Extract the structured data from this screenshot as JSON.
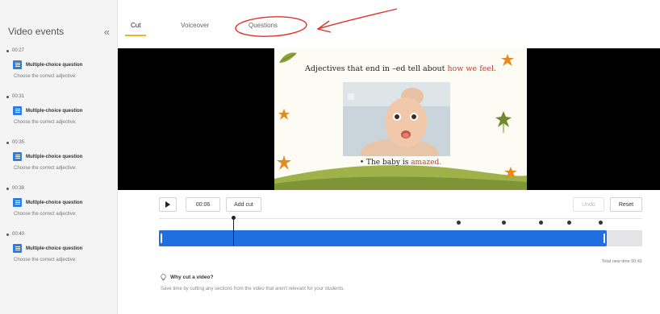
{
  "sidebar": {
    "title": "Video events",
    "collapse_icon": "double-chevron-left-icon",
    "events": [
      {
        "time": "00:27",
        "type": "Multiple-choice question",
        "prompt": "Choose the correct adjective:"
      },
      {
        "time": "00:31",
        "type": "Multiple-choice question",
        "prompt": "Choose the correct adjective:"
      },
      {
        "time": "00:35",
        "type": "Multiple-choice question",
        "prompt": "Choose the correct adjective:"
      },
      {
        "time": "00:38",
        "type": "Multiple-choice question",
        "prompt": "Choose the correct adjective:"
      },
      {
        "time": "00:40",
        "type": "Multiple-choice question",
        "prompt": "Choose the correct adjective:"
      }
    ]
  },
  "tabs": [
    {
      "label": "Cut",
      "active": true
    },
    {
      "label": "Voiceover",
      "active": false
    },
    {
      "label": "Questions",
      "active": false
    }
  ],
  "slide": {
    "title_main": "Adjectives that end in –ed tell about ",
    "title_highlight": "how we feel.",
    "caption_main": "• The baby is ",
    "caption_highlight": "amazed.",
    "highlight_color": "#e0312b"
  },
  "controls": {
    "play_icon": "play-icon",
    "time": "00:06",
    "add_cut": "Add cut",
    "undo": "Undo",
    "reset": "Reset"
  },
  "timeline": {
    "total": "Total new time 00:41",
    "accent_color": "#1f6fe0"
  },
  "tip": {
    "icon": "lightbulb-icon",
    "title": "Why cut a video?",
    "description": "Save time by cutting any sections from the video that aren't relevant for your students."
  },
  "colors": {
    "tab_underline": "#f0b323",
    "annotation": "#e0312b",
    "event_icon": "#2e7de0"
  }
}
